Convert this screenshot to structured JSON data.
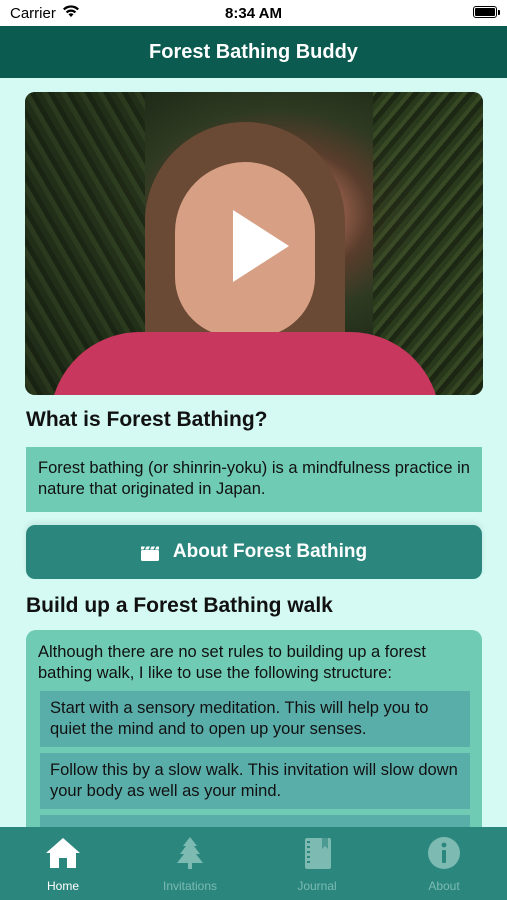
{
  "status_bar": {
    "carrier": "Carrier",
    "time": "8:34 AM"
  },
  "nav": {
    "title": "Forest Bathing Buddy"
  },
  "video": {
    "play_icon": "play-icon"
  },
  "section1": {
    "title": "What is Forest Bathing?",
    "text": "Forest bathing (or shinrin-yoku) is a mindfulness practice in nature that originated in Japan."
  },
  "about_button": {
    "label": "About Forest Bathing",
    "icon": "clapperboard-icon"
  },
  "section2": {
    "title": "Build up a Forest Bathing walk",
    "intro": "Although there are no set rules to building up a forest bathing walk, I like to use the following structure:",
    "steps": [
      "Start with a sensory meditation. This will help you to quiet the mind and to open up your senses.",
      "Follow this by a slow walk. This invitation will slow down your body as well as your mind."
    ]
  },
  "tabs": [
    {
      "label": "Home",
      "icon": "home-icon"
    },
    {
      "label": "Invitations",
      "icon": "tree-icon"
    },
    {
      "label": "Journal",
      "icon": "journal-icon"
    },
    {
      "label": "About",
      "icon": "info-icon"
    }
  ],
  "colors": {
    "nav_bg": "#0b5b50",
    "page_bg": "#d4faf3",
    "box_bg": "#6fcbb4",
    "button_bg": "#2b877e",
    "tab_bar_bg": "#2b877e"
  }
}
